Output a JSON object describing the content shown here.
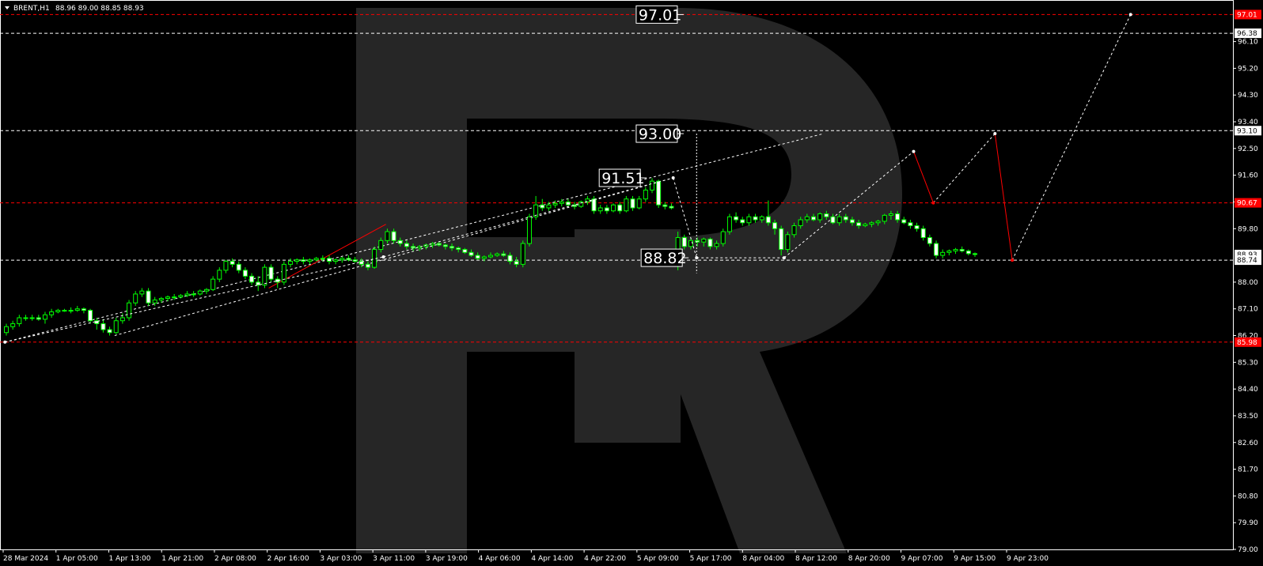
{
  "symbol_label": "BRENT,H1",
  "ohlc_label": "88.96 89.00 88.85 88.93",
  "colors": {
    "background": "#000000",
    "candle_up_fill": "#000000",
    "candle_down_fill": "#ffffff",
    "candle_stroke": "#00ff00",
    "grid_dash": "#ffffff",
    "red_line": "#ff0000",
    "watermark": "#262626"
  },
  "chart_data": {
    "type": "candlestick",
    "timeframe": "H1",
    "ylim": [
      79.0,
      97.5
    ],
    "y_ticks": [
      79.0,
      79.9,
      80.8,
      81.7,
      82.6,
      83.5,
      84.4,
      85.3,
      86.2,
      87.1,
      88.0,
      89.8,
      90.7,
      91.6,
      92.5,
      93.4,
      94.3,
      95.2,
      96.1
    ],
    "x_tick_labels": [
      "28 Mar 2024",
      "1 Apr 05:00",
      "1 Apr 13:00",
      "1 Apr 21:00",
      "2 Apr 08:00",
      "2 Apr 16:00",
      "3 Apr 03:00",
      "3 Apr 11:00",
      "3 Apr 19:00",
      "4 Apr 06:00",
      "4 Apr 14:00",
      "4 Apr 22:00",
      "5 Apr 09:00",
      "5 Apr 17:00",
      "8 Apr 04:00",
      "8 Apr 12:00",
      "8 Apr 20:00",
      "9 Apr 07:00",
      "9 Apr 15:00",
      "9 Apr 23:00"
    ],
    "price_tags": [
      {
        "value": "97.01",
        "style": "red"
      },
      {
        "value": "96.38",
        "style": "white"
      },
      {
        "value": "93.10",
        "style": "white"
      },
      {
        "value": "90.67",
        "style": "red"
      },
      {
        "value": "88.93",
        "style": "white"
      },
      {
        "value": "88.74",
        "style": "white"
      },
      {
        "value": "85.98",
        "style": "red"
      }
    ],
    "horizontal_levels": [
      {
        "price": 97.01,
        "style": "red-dash"
      },
      {
        "price": 96.38,
        "style": "white-dash"
      },
      {
        "price": 93.1,
        "style": "white-dash"
      },
      {
        "price": 90.67,
        "style": "red-dash"
      },
      {
        "price": 88.74,
        "style": "white-dash"
      },
      {
        "price": 85.98,
        "style": "red-dash"
      }
    ],
    "annotations": [
      "97.01",
      "93.00",
      "91.51",
      "88.82"
    ],
    "candles": [
      [
        86.3,
        86.6,
        86.2,
        86.5
      ],
      [
        86.5,
        86.7,
        86.4,
        86.6
      ],
      [
        86.6,
        86.9,
        86.5,
        86.8
      ],
      [
        86.8,
        86.9,
        86.7,
        86.8
      ],
      [
        86.8,
        86.9,
        86.7,
        86.8
      ],
      [
        86.8,
        86.9,
        86.7,
        86.75
      ],
      [
        86.75,
        87.0,
        86.6,
        86.9
      ],
      [
        86.9,
        87.1,
        86.8,
        87.0
      ],
      [
        87.0,
        87.1,
        86.95,
        87.05
      ],
      [
        87.05,
        87.1,
        87.0,
        87.05
      ],
      [
        87.05,
        87.15,
        86.95,
        87.05
      ],
      [
        87.05,
        87.2,
        87.0,
        87.1
      ],
      [
        87.1,
        87.15,
        86.95,
        87.05
      ],
      [
        87.05,
        87.1,
        86.6,
        86.7
      ],
      [
        86.7,
        86.8,
        86.4,
        86.6
      ],
      [
        86.6,
        86.75,
        86.3,
        86.4
      ],
      [
        86.4,
        86.5,
        86.2,
        86.3
      ],
      [
        86.3,
        86.8,
        86.25,
        86.7
      ],
      [
        86.7,
        86.95,
        86.6,
        86.8
      ],
      [
        86.8,
        87.4,
        86.7,
        87.3
      ],
      [
        87.3,
        87.7,
        87.2,
        87.6
      ],
      [
        87.6,
        87.8,
        87.5,
        87.7
      ],
      [
        87.7,
        87.8,
        87.2,
        87.3
      ],
      [
        87.3,
        87.5,
        87.2,
        87.4
      ],
      [
        87.4,
        87.5,
        87.3,
        87.45
      ],
      [
        87.45,
        87.55,
        87.35,
        87.5
      ],
      [
        87.5,
        87.6,
        87.4,
        87.5
      ],
      [
        87.5,
        87.6,
        87.45,
        87.55
      ],
      [
        87.55,
        87.7,
        87.5,
        87.6
      ],
      [
        87.6,
        87.7,
        87.5,
        87.6
      ],
      [
        87.6,
        87.75,
        87.55,
        87.7
      ],
      [
        87.7,
        87.8,
        87.6,
        87.75
      ],
      [
        87.75,
        88.2,
        87.7,
        88.1
      ],
      [
        88.1,
        88.5,
        88.0,
        88.4
      ],
      [
        88.4,
        88.75,
        88.3,
        88.7
      ],
      [
        88.7,
        88.8,
        88.5,
        88.6
      ],
      [
        88.6,
        88.7,
        88.3,
        88.4
      ],
      [
        88.4,
        88.5,
        88.1,
        88.2
      ],
      [
        88.2,
        88.3,
        87.9,
        88.0
      ],
      [
        88.0,
        88.2,
        87.7,
        87.9
      ],
      [
        87.9,
        88.6,
        87.8,
        88.5
      ],
      [
        88.5,
        88.6,
        88.0,
        88.1
      ],
      [
        88.1,
        88.2,
        87.8,
        88.0
      ],
      [
        88.0,
        88.7,
        87.9,
        88.6
      ],
      [
        88.6,
        88.8,
        88.5,
        88.7
      ],
      [
        88.7,
        88.8,
        88.6,
        88.75
      ],
      [
        88.75,
        88.85,
        88.6,
        88.7
      ],
      [
        88.7,
        88.8,
        88.6,
        88.75
      ],
      [
        88.75,
        88.85,
        88.7,
        88.8
      ],
      [
        88.8,
        88.9,
        88.7,
        88.8
      ],
      [
        88.8,
        88.9,
        88.6,
        88.7
      ],
      [
        88.7,
        88.8,
        88.6,
        88.75
      ],
      [
        88.75,
        88.85,
        88.65,
        88.8
      ],
      [
        88.8,
        88.9,
        88.7,
        88.75
      ],
      [
        88.75,
        88.85,
        88.65,
        88.7
      ],
      [
        88.7,
        88.8,
        88.5,
        88.6
      ],
      [
        88.6,
        88.7,
        88.4,
        88.5
      ],
      [
        88.5,
        89.2,
        88.45,
        89.1
      ],
      [
        89.1,
        89.5,
        89.0,
        89.4
      ],
      [
        89.4,
        89.8,
        89.3,
        89.7
      ],
      [
        89.7,
        89.8,
        89.3,
        89.4
      ],
      [
        89.4,
        89.5,
        89.2,
        89.3
      ],
      [
        89.3,
        89.4,
        89.1,
        89.2
      ],
      [
        89.2,
        89.3,
        89.05,
        89.15
      ],
      [
        89.15,
        89.25,
        89.05,
        89.2
      ],
      [
        89.2,
        89.3,
        89.1,
        89.25
      ],
      [
        89.25,
        89.35,
        89.15,
        89.3
      ],
      [
        89.3,
        89.35,
        89.2,
        89.25
      ],
      [
        89.25,
        89.3,
        89.1,
        89.2
      ],
      [
        89.2,
        89.3,
        89.05,
        89.15
      ],
      [
        89.15,
        89.2,
        89.0,
        89.1
      ],
      [
        89.1,
        89.15,
        88.95,
        89.0
      ],
      [
        89.0,
        89.1,
        88.85,
        88.9
      ],
      [
        88.9,
        89.0,
        88.75,
        88.8
      ],
      [
        88.8,
        88.9,
        88.7,
        88.85
      ],
      [
        88.85,
        89.0,
        88.8,
        88.9
      ],
      [
        88.9,
        89.0,
        88.85,
        88.95
      ],
      [
        88.95,
        89.05,
        88.85,
        88.9
      ],
      [
        88.9,
        89.0,
        88.6,
        88.7
      ],
      [
        88.7,
        88.85,
        88.5,
        88.6
      ],
      [
        88.6,
        89.4,
        88.5,
        89.3
      ],
      [
        89.3,
        90.3,
        89.2,
        90.2
      ],
      [
        90.2,
        90.9,
        90.1,
        90.6
      ],
      [
        90.6,
        90.8,
        90.4,
        90.5
      ],
      [
        90.5,
        90.7,
        90.4,
        90.6
      ],
      [
        90.6,
        90.75,
        90.5,
        90.65
      ],
      [
        90.65,
        90.8,
        90.55,
        90.7
      ],
      [
        90.7,
        90.8,
        90.55,
        90.6
      ],
      [
        90.6,
        90.7,
        90.45,
        90.55
      ],
      [
        90.55,
        90.75,
        90.5,
        90.7
      ],
      [
        90.7,
        90.9,
        90.6,
        90.8
      ],
      [
        90.8,
        90.9,
        90.3,
        90.4
      ],
      [
        90.4,
        90.6,
        90.3,
        90.5
      ],
      [
        90.5,
        90.6,
        90.3,
        90.4
      ],
      [
        90.4,
        90.65,
        90.35,
        90.6
      ],
      [
        90.6,
        90.7,
        90.3,
        90.4
      ],
      [
        90.4,
        90.9,
        90.35,
        90.8
      ],
      [
        90.8,
        90.9,
        90.4,
        90.5
      ],
      [
        90.5,
        90.9,
        90.45,
        90.8
      ],
      [
        90.8,
        91.2,
        90.7,
        91.1
      ],
      [
        91.1,
        91.5,
        91.0,
        91.4
      ],
      [
        91.4,
        91.45,
        90.5,
        90.6
      ],
      [
        90.6,
        90.7,
        90.45,
        90.55
      ],
      [
        90.55,
        90.65,
        90.45,
        90.5
      ],
      [
        88.9,
        89.7,
        88.4,
        89.5
      ],
      [
        89.5,
        89.6,
        89.1,
        89.2
      ],
      [
        89.2,
        89.5,
        89.1,
        89.4
      ],
      [
        89.4,
        89.5,
        89.2,
        89.35
      ],
      [
        89.35,
        89.5,
        89.2,
        89.45
      ],
      [
        89.45,
        89.5,
        89.1,
        89.2
      ],
      [
        89.2,
        89.4,
        89.1,
        89.3
      ],
      [
        89.3,
        89.8,
        89.2,
        89.7
      ],
      [
        89.7,
        90.3,
        89.6,
        90.2
      ],
      [
        90.2,
        90.35,
        90.0,
        90.1
      ],
      [
        90.1,
        90.2,
        89.9,
        90.0
      ],
      [
        90.0,
        90.3,
        89.9,
        90.2
      ],
      [
        90.2,
        90.3,
        90.0,
        90.1
      ],
      [
        90.1,
        90.25,
        90.0,
        90.2
      ],
      [
        90.2,
        90.75,
        89.9,
        90.0
      ],
      [
        90.0,
        90.1,
        89.6,
        89.8
      ],
      [
        89.8,
        89.9,
        88.9,
        89.1
      ],
      [
        89.1,
        89.7,
        89.0,
        89.6
      ],
      [
        89.6,
        90.0,
        89.5,
        89.9
      ],
      [
        89.9,
        90.2,
        89.8,
        90.1
      ],
      [
        90.1,
        90.3,
        90.0,
        90.2
      ],
      [
        90.2,
        90.3,
        90.05,
        90.1
      ],
      [
        90.1,
        90.35,
        90.0,
        90.3
      ],
      [
        90.3,
        90.4,
        90.1,
        90.2
      ],
      [
        90.2,
        90.3,
        89.95,
        90.0
      ],
      [
        90.0,
        90.3,
        89.9,
        90.2
      ],
      [
        90.2,
        90.3,
        90.0,
        90.1
      ],
      [
        90.1,
        90.2,
        89.9,
        90.0
      ],
      [
        90.0,
        90.1,
        89.8,
        89.9
      ],
      [
        89.9,
        90.0,
        89.85,
        89.95
      ],
      [
        89.95,
        90.05,
        89.85,
        90.0
      ],
      [
        90.0,
        90.1,
        89.9,
        90.05
      ],
      [
        90.05,
        90.3,
        89.95,
        90.25
      ],
      [
        90.25,
        90.4,
        90.1,
        90.3
      ],
      [
        90.3,
        90.4,
        90.0,
        90.1
      ],
      [
        90.1,
        90.2,
        89.95,
        90.0
      ],
      [
        90.0,
        90.1,
        89.8,
        89.9
      ],
      [
        89.9,
        90.0,
        89.7,
        89.8
      ],
      [
        89.8,
        89.9,
        89.4,
        89.5
      ],
      [
        89.5,
        89.6,
        89.2,
        89.3
      ],
      [
        89.3,
        89.4,
        88.8,
        88.9
      ],
      [
        88.9,
        89.1,
        88.8,
        89.0
      ],
      [
        89.0,
        89.1,
        88.9,
        89.05
      ],
      [
        89.05,
        89.15,
        88.95,
        89.1
      ],
      [
        89.1,
        89.2,
        89.0,
        89.05
      ],
      [
        89.05,
        89.1,
        88.9,
        88.96
      ],
      [
        88.96,
        89.0,
        88.85,
        88.93
      ]
    ],
    "forecast_path": [
      {
        "x_frac": 0.004,
        "price": 85.98,
        "color": "white"
      },
      {
        "x_frac": 0.311,
        "price": 88.85,
        "color": "white"
      },
      {
        "x_frac": 0.546,
        "price": 91.51,
        "color": "white"
      },
      {
        "x_frac": 0.565,
        "price": 88.82,
        "color": "white"
      },
      {
        "x_frac": 0.636,
        "price": 88.82,
        "color": "white"
      },
      {
        "x_frac": 0.741,
        "price": 92.4,
        "color": "white"
      },
      {
        "x_frac": 0.757,
        "price": 90.67,
        "color": "red"
      },
      {
        "x_frac": 0.807,
        "price": 93.0,
        "color": "white"
      },
      {
        "x_frac": 0.821,
        "price": 88.74,
        "color": "red"
      },
      {
        "x_frac": 0.917,
        "price": 97.01,
        "color": "white"
      }
    ]
  }
}
